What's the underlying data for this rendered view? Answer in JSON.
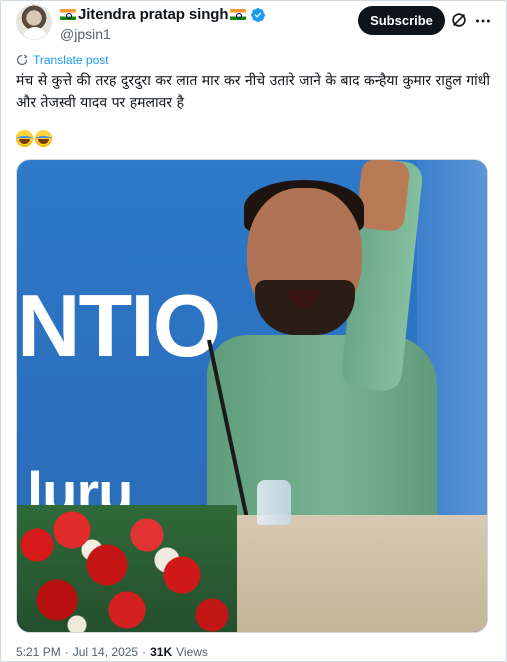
{
  "post": {
    "author": {
      "display_name": "Jitendra pratap singh",
      "handle": "@jpsin1",
      "verified": true,
      "flag_icons": [
        "india-flag-icon",
        "india-flag-icon"
      ]
    },
    "actions": {
      "subscribe_label": "Subscribe",
      "grok_icon": "grok-icon",
      "more_icon": "more-icon"
    },
    "translate_label": "Translate post",
    "text": "मंच से कुत्ते की तरह दुरदुरा कर लात मार कर नीचे उतारे जाने के बाद कन्हैया कुमार राहुल गांधी और तेजस्वी यादव पर हमलावर है",
    "emoji_line": [
      "face-with-tears-of-joy",
      "face-with-tears-of-joy"
    ],
    "media": {
      "backdrop_text_top": "NTIO",
      "backdrop_text_bottom": "luru"
    },
    "meta": {
      "time": "5:21 PM",
      "separator": "·",
      "date": "Jul 14, 2025",
      "views_count": "31K",
      "views_label": "Views"
    }
  },
  "colors": {
    "accent": "#1d9bf0",
    "text_primary": "#0f1419",
    "text_secondary": "#536471",
    "subscribe_bg": "#0f1419"
  }
}
